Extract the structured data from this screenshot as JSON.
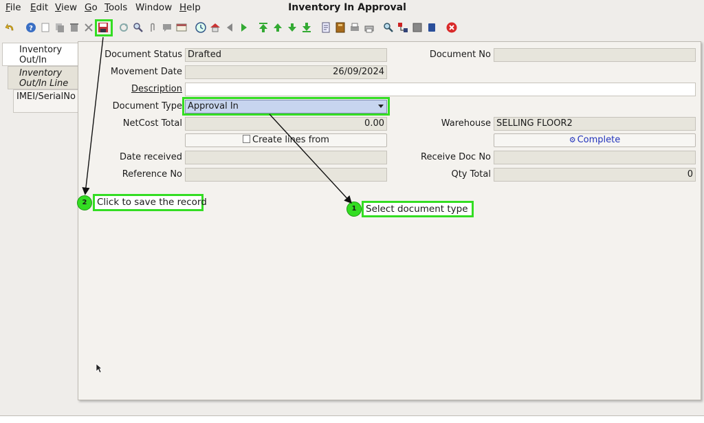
{
  "window": {
    "title": "Inventory In Approval"
  },
  "menu": [
    {
      "key": "F",
      "rest": "ile"
    },
    {
      "key": "E",
      "rest": "dit"
    },
    {
      "key": "V",
      "rest": "iew"
    },
    {
      "key": "G",
      "rest": "o"
    },
    {
      "key": "T",
      "rest": "ools"
    },
    {
      "key": "",
      "rest": "Window"
    },
    {
      "key": "H",
      "rest": "elp"
    }
  ],
  "tabs": [
    {
      "line1": "Inventory",
      "line2": "Out/In"
    },
    {
      "line1": "Inventory",
      "line2": "Out/In Line"
    },
    {
      "line1": "IMEI/SerialNo",
      "line2": ""
    }
  ],
  "form": {
    "document_status": {
      "label": "Document Status",
      "value": "Drafted"
    },
    "document_no": {
      "label": "Document No",
      "value": ""
    },
    "movement_date": {
      "label": "Movement Date",
      "value": "26/09/2024"
    },
    "description": {
      "label": "Description",
      "value": ""
    },
    "document_type": {
      "label": "Document Type",
      "value": "Approval In"
    },
    "netcost_total": {
      "label": "NetCost Total",
      "value": "0.00"
    },
    "warehouse": {
      "label": "Warehouse",
      "value": "SELLING FLOOR2"
    },
    "create_lines_from": "Create lines from",
    "complete": "Complete",
    "date_received": {
      "label": "Date received",
      "value": ""
    },
    "receive_doc_no": {
      "label": "Receive Doc No",
      "value": ""
    },
    "reference_no": {
      "label": "Reference No",
      "value": ""
    },
    "qty_total": {
      "label": "Qty Total",
      "value": "0"
    }
  },
  "annotations": [
    {
      "number": "1",
      "text": "Select document type"
    },
    {
      "number": "2",
      "text": "Click to save the record"
    }
  ],
  "colors": {
    "highlight": "#33dd22",
    "select_bg": "#c7d5ef",
    "field_bg": "#e7e5dc",
    "complete_text": "#2233bb"
  }
}
